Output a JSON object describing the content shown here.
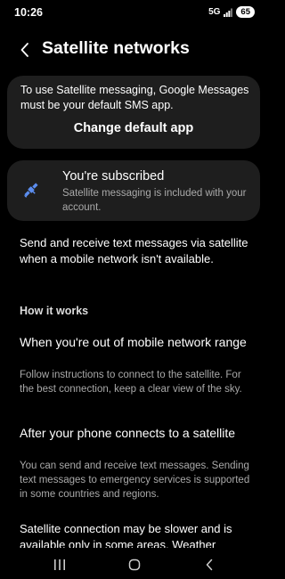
{
  "status_bar": {
    "time": "10:26",
    "network": "5G",
    "battery": "65"
  },
  "header": {
    "title": "Satellite networks",
    "back_icon": "chevron-left-icon"
  },
  "sms_card": {
    "message": "To use Satellite messaging, Google Messages must be your default SMS app.",
    "button_label": "Change default app"
  },
  "subscription_card": {
    "icon": "satellite-icon",
    "accent_color": "#5b8def",
    "title": "You're subscribed",
    "description": "Satellite messaging is included with your account."
  },
  "intro_text": "Send and receive text messages via satellite when a mobile network isn't available.",
  "how_it_works": {
    "heading": "How it works",
    "items": [
      {
        "title": "When you're out of mobile network range",
        "description": "Follow instructions to connect to the satellite. For the best connection, keep a clear view of the sky."
      },
      {
        "title": "After your phone connects to a satellite",
        "description": "You can send and receive text messages. Sending text messages to emergency services is supported in some countries and regions."
      }
    ]
  },
  "bottom_text": "Satellite connection may be slower and is available only in some areas. Weather",
  "nav_bar": {
    "recents_icon": "recents-icon",
    "home_icon": "home-icon",
    "back_icon": "back-icon"
  }
}
